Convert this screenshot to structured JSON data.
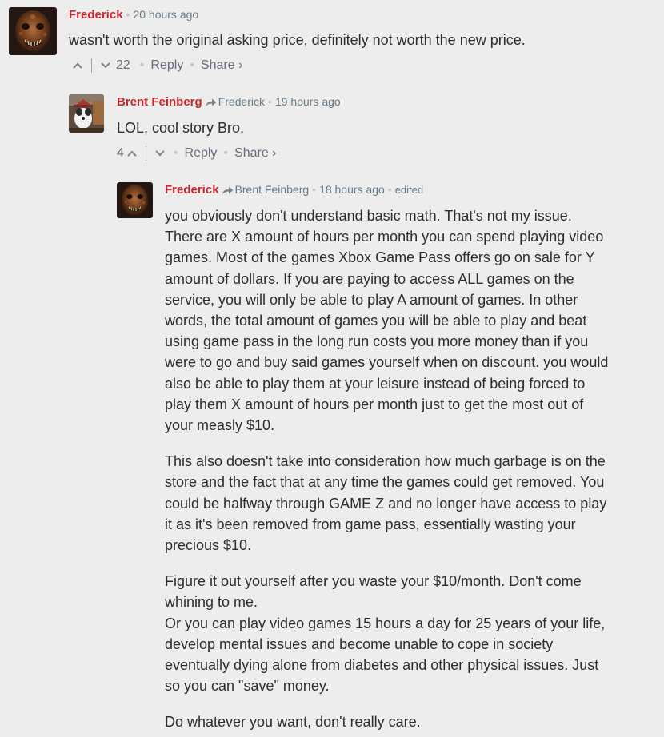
{
  "comments": [
    {
      "author": "Frederick",
      "time": "20 hours ago",
      "text": [
        "wasn't worth the original asking price, definitely not worth the new price."
      ],
      "upvotes": "",
      "downvotes": "22",
      "reply_label": "Reply",
      "share_label": "Share ›"
    },
    {
      "author": "Brent Feinberg",
      "reply_to": "Frederick",
      "time": "19 hours ago",
      "text": [
        "LOL, cool story Bro."
      ],
      "upvotes": "4",
      "downvotes": "",
      "reply_label": "Reply",
      "share_label": "Share ›"
    },
    {
      "author": "Frederick",
      "reply_to": "Brent Feinberg",
      "time": "18 hours ago",
      "edited": "edited",
      "text": [
        "you obviously don't understand basic math. That's not my issue. There are X amount of hours per month you can spend playing video games. Most of the games Xbox Game Pass offers go on sale for Y amount of dollars. If you are paying to access ALL games on the service, you will only be able to play A amount of games. In other words, the total amount of games you will be able to play and beat using game pass in the long run costs you more money than if you were to go and buy said games yourself when on discount. you would also be able to play them at your leisure instead of being forced to play them X amount of hours per month just to get the most out of your measly $10.",
        "This also doesn't take into consideration how much garbage is on the store and the fact that at any time the games could get removed. You could be halfway through GAME Z and no longer have access to play it as it's been removed from game pass, essentially wasting your precious $10.",
        "Figure it out yourself after you waste your $10/month. Don't come whining to me.",
        "Or you can play video games 15 hours a day for 25 years of your life, develop mental issues and become unable to cope in society eventually dying alone from diabetes and other physical issues. Just so you can \"save\" money.",
        "Do whatever you want, don't really care."
      ]
    }
  ],
  "colors": {
    "author": "#c9272d",
    "meta": "#687a86",
    "text": "#2a2e2e",
    "background": "#ededed"
  }
}
